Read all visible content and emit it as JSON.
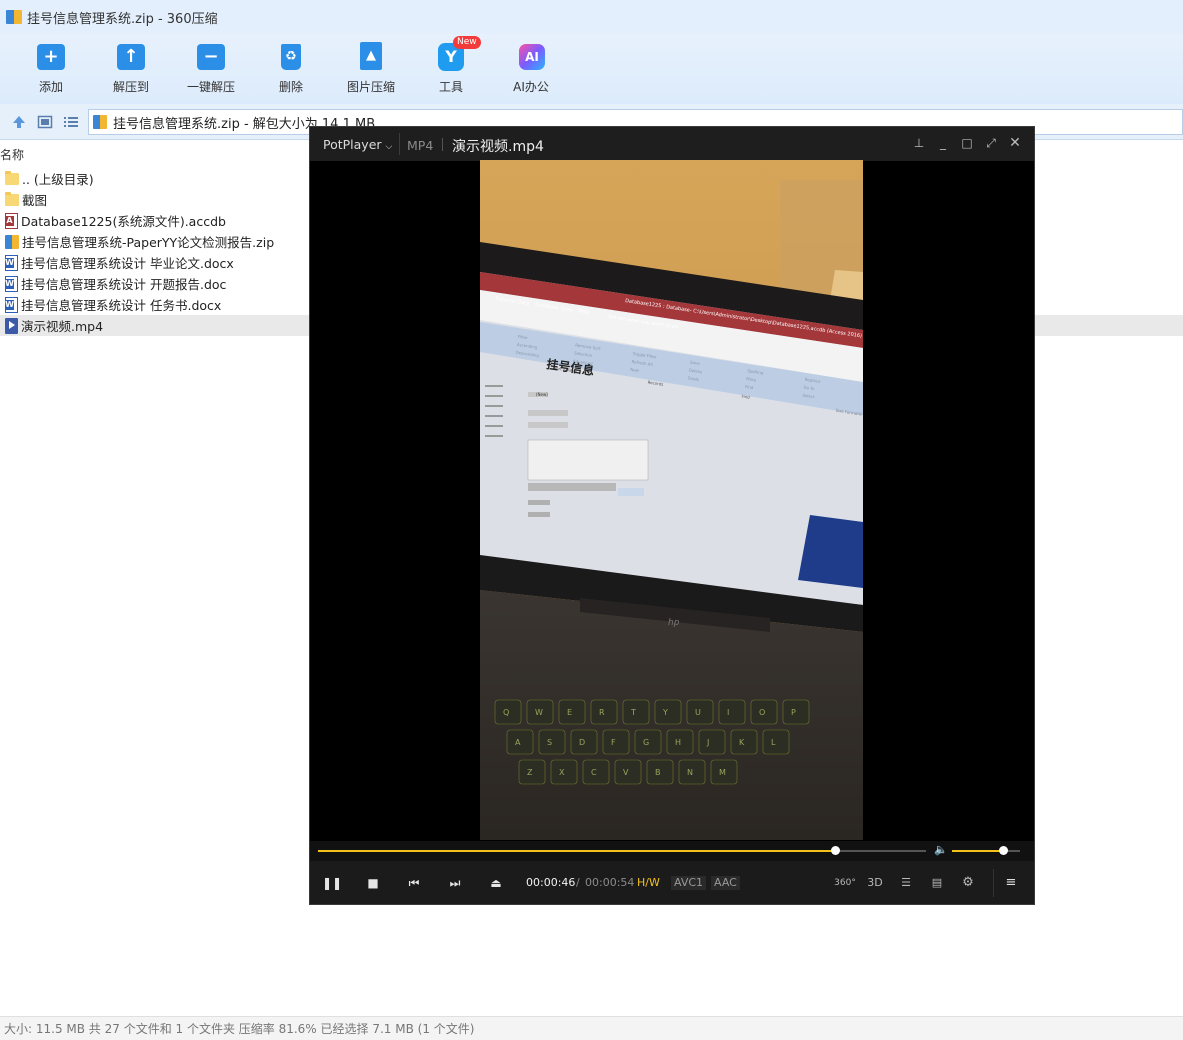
{
  "window": {
    "title": "挂号信息管理系统.zip - 360压缩"
  },
  "toolbar": {
    "items": [
      {
        "label": "添加",
        "icon": "add-file-icon"
      },
      {
        "label": "解压到",
        "icon": "extract-to-icon"
      },
      {
        "label": "一键解压",
        "icon": "one-click-extract-icon"
      },
      {
        "label": "删除",
        "icon": "delete-icon"
      },
      {
        "label": "图片压缩",
        "icon": "image-compress-icon"
      },
      {
        "label": "工具",
        "icon": "tools-icon",
        "badge": "New"
      },
      {
        "label": "AI办公",
        "icon": "ai-office-icon",
        "glyph": "AI"
      }
    ]
  },
  "address": {
    "path": "挂号信息管理系统.zip - 解包大小为 14.1 MB"
  },
  "filelist": {
    "column_name": "名称",
    "files": [
      {
        "name": ".. (上级目录)",
        "icon": "folder-icon"
      },
      {
        "name": "截图",
        "icon": "folder-icon"
      },
      {
        "name": "Database1225(系统源文件).accdb",
        "icon": "access-file-icon"
      },
      {
        "name": "挂号信息管理系统-PaperYY论文检测报告.zip",
        "icon": "zip-file-icon"
      },
      {
        "name": "挂号信息管理系统设计 毕业论文.docx",
        "icon": "word-file-icon"
      },
      {
        "name": "挂号信息管理系统设计 开题报告.doc",
        "icon": "word-file-icon"
      },
      {
        "name": "挂号信息管理系统设计 任务书.docx",
        "icon": "word-file-icon"
      },
      {
        "name": "演示视频.mp4",
        "icon": "video-file-icon",
        "selected": true
      }
    ]
  },
  "status": {
    "text": "大小: 11.5 MB 共 27 个文件和 1 个文件夹 压缩率 81.6% 已经选择 7.1 MB (1 个文件)"
  },
  "player": {
    "brand": "PotPlayer",
    "format": "MP4",
    "filename": "演示视频.mp4",
    "time_current": "00:00:46",
    "time_separator": "/",
    "time_total": "00:00:54",
    "progress_fraction": 0.85,
    "volume_fraction": 0.75,
    "tag_hw": "H/W",
    "tag_video_codec": "AVC1",
    "tag_audio_codec": "AAC",
    "btn_360": "360°",
    "btn_3d": "3D",
    "accent_color": "#f2c21b",
    "video_frame": {
      "window_title": "Database1225 : Database- C:\\Users\\Administrator\\Desktop\\Database1225.accdb (Access 2016) - Access",
      "form_title": "挂号信息",
      "ribbon_tabs": [
        "External Data",
        "Database Tools",
        "Help"
      ],
      "tell_me": "Tell me what you want to do",
      "ribbon_group_labels": [
        "Sort & Filter",
        "Records",
        "Find",
        "Text Formatting"
      ],
      "ribbon_buttons": [
        "Filter",
        "Ascending",
        "Descending",
        "Remove Sort",
        "Selection",
        "Advanced",
        "Toggle Filter",
        "Refresh All",
        "New",
        "Save",
        "Delete",
        "Totals",
        "Spelling",
        "More",
        "Find",
        "Replace",
        "Go To",
        "Select"
      ],
      "new_record": "(New)",
      "laptop_brand": "hp",
      "keyboard_row1": [
        "Q",
        "W",
        "E",
        "R",
        "T",
        "Y",
        "U",
        "I",
        "O",
        "P"
      ],
      "keyboard_row2": [
        "A",
        "S",
        "D",
        "F",
        "G",
        "H",
        "J",
        "K",
        "L"
      ],
      "keyboard_row3": [
        "Z",
        "X",
        "C",
        "V",
        "B",
        "N",
        "M"
      ]
    }
  }
}
